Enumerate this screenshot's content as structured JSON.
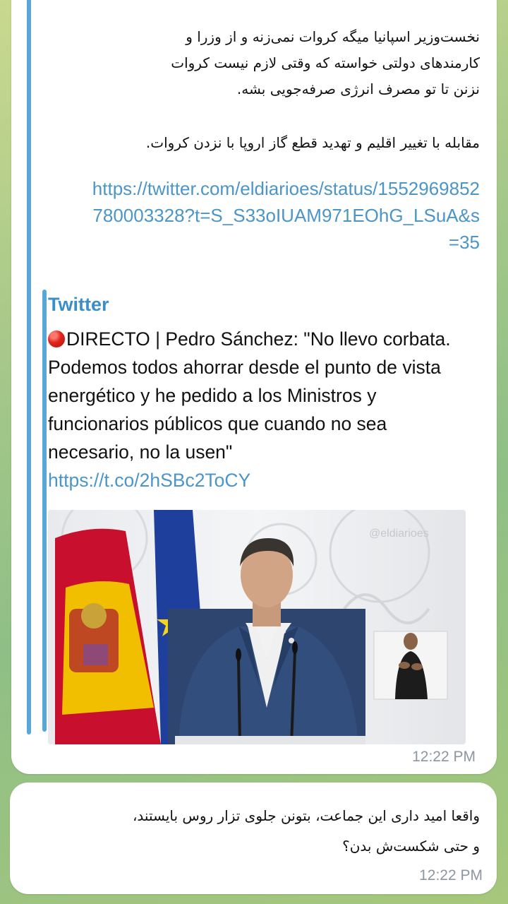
{
  "message1": {
    "text_paragraph1": "نخست‌وزیر اسپانیا میگه کروات نمی‌زنه و از وزرا و\nکارمندهای دولتی خواسته که وقتی لازم نیست کروات\nنزنن تا تو مصرف انرژی صرفه‌جویی بشه.",
    "text_paragraph2": "مقابله با تغییر اقلیم و تهدید قطع گاز اروپا با نزدن کروات.",
    "link": "https://twitter.com/eldiarioes/status/1552969852780003328?t=S_S33oIUAM971EOhG_LSuA&s=35",
    "preview": {
      "site_name": "Twitter",
      "description": "DIRECTO | Pedro Sánchez: \"No llevo corbata. Podemos todos ahorrar desde el punto de vista energético y he pedido a los Ministros y funcionarios públicos que cuando no sea necesario, no la usen\"",
      "short_link": "https://t.co/2hSBc2ToCY",
      "image_watermark": "@eldiarioes"
    },
    "time": "12:22 PM"
  },
  "message2": {
    "text": "واقعا امید داری این جماعت، بتونن جلوی تزار روس بایستند،\nو حتی شکست‌ش بدن؟",
    "time": "12:22 PM"
  },
  "colors": {
    "accent_blue": "#59a6d9",
    "link_blue": "#4b95c9",
    "time_gray": "#8d969f"
  }
}
